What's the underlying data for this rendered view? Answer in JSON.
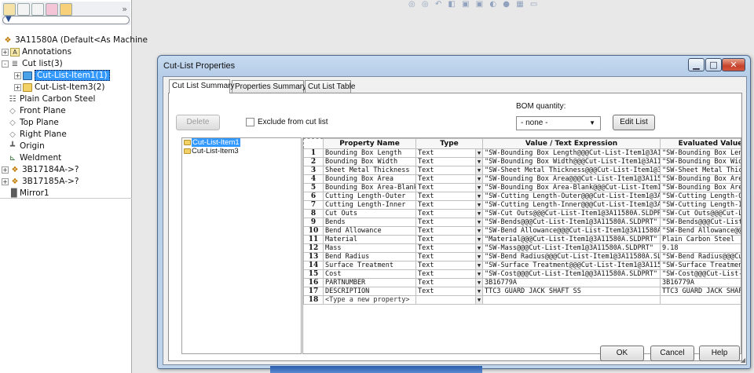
{
  "feature_manager": {
    "root_label": "3A11580A  (Default<As Machine",
    "items": [
      {
        "label": "Annotations",
        "icon": "annotation-icon",
        "expand": "+"
      },
      {
        "label": "Cut list(3)",
        "icon": "cut-list-icon",
        "expand": "-"
      },
      {
        "label": "Cut-List-Item1(1)",
        "icon": "folder-icon",
        "expand": "+",
        "selected": true
      },
      {
        "label": "Cut-List-Item3(2)",
        "icon": "folder-icon",
        "expand": "+"
      },
      {
        "label": "Plain Carbon Steel",
        "icon": "material-icon"
      },
      {
        "label": "Front Plane",
        "icon": "plane-icon"
      },
      {
        "label": "Top Plane",
        "icon": "plane-icon"
      },
      {
        "label": "Right Plane",
        "icon": "plane-icon"
      },
      {
        "label": "Origin",
        "icon": "origin-icon"
      },
      {
        "label": "Weldment",
        "icon": "weldment-icon"
      },
      {
        "label": "3B17184A->?",
        "icon": "part-icon",
        "expand": "+"
      },
      {
        "label": "3B17185A->?",
        "icon": "part-icon",
        "expand": "+"
      },
      {
        "label": "Mirror1",
        "icon": "mirror-icon"
      }
    ],
    "collapse_glyph": "»"
  },
  "dialog": {
    "title": "Cut-List Properties",
    "tabs": [
      "Cut List Summary",
      "Properties Summary",
      "Cut List Table"
    ],
    "delete_label": "Delete",
    "exclude_label": "Exclude from cut list",
    "bom_quantity_label": "BOM quantity:",
    "bom_quantity_value": "- none -",
    "edit_list_label": "Edit List",
    "cut_list_items": [
      "Cut-List-Item1",
      "Cut-List-Item3"
    ],
    "columns": [
      "Property Name",
      "Type",
      "Value / Text Expression",
      "Evaluated Value"
    ],
    "rows": [
      {
        "num": "1",
        "name": "Bounding Box Length",
        "type": "Text",
        "value": "\"SW-Bounding Box Length@@@Cut-List-Item1@3A115",
        "evaluated": "\"SW-Bounding Box Length@"
      },
      {
        "num": "2",
        "name": "Bounding Box Width",
        "type": "Text",
        "value": "\"SW-Bounding Box Width@@@Cut-List-Item1@3A1158",
        "evaluated": "\"SW-Bounding Box Width@"
      },
      {
        "num": "3",
        "name": "Sheet Metal Thickness",
        "type": "Text",
        "value": "\"SW-Sheet Metal Thickness@@@Cut-List-Item1@3A1",
        "evaluated": "\"SW-Sheet Metal Thickness"
      },
      {
        "num": "4",
        "name": "Bounding Box Area",
        "type": "Text",
        "value": "\"SW-Bounding Box Area@@@Cut-List-Item1@3A1158",
        "evaluated": "\"SW-Bounding Box Area@@"
      },
      {
        "num": "5",
        "name": "Bounding Box Area-Blank",
        "type": "Text",
        "value": "\"SW-Bounding Box Area-Blank@@@Cut-List-Item1@3",
        "evaluated": "\"SW-Bounding Box Area-Bla"
      },
      {
        "num": "6",
        "name": "Cutting Length-Outer",
        "type": "Text",
        "value": "\"SW-Cutting Length-Outer@@@Cut-List-Item1@3A115",
        "evaluated": "\"SW-Cutting Length-Outer@"
      },
      {
        "num": "7",
        "name": "Cutting Length-Inner",
        "type": "Text",
        "value": "\"SW-Cutting Length-Inner@@@Cut-List-Item1@3A115",
        "evaluated": "\"SW-Cutting Length-Inner@"
      },
      {
        "num": "8",
        "name": "Cut Outs",
        "type": "Text",
        "value": "\"SW-Cut Outs@@@Cut-List-Item1@3A11580A.SLDPRT",
        "evaluated": "\"SW-Cut Outs@@@Cut-List"
      },
      {
        "num": "9",
        "name": "Bends",
        "type": "Text",
        "value": "\"SW-Bends@@@Cut-List-Item1@3A11580A.SLDPRT\"",
        "evaluated": "\"SW-Bends@@@Cut-List-It"
      },
      {
        "num": "10",
        "name": "Bend Allowance",
        "type": "Text",
        "value": "\"SW-Bend Allowance@@@Cut-List-Item1@3A11580A.",
        "evaluated": "\"SW-Bend Allowance@@@"
      },
      {
        "num": "11",
        "name": "Material",
        "type": "Text",
        "value": "\"Material@@@Cut-List-Item1@3A11580A.SLDPRT\"",
        "evaluated": "Plain Carbon Steel"
      },
      {
        "num": "12",
        "name": "Mass",
        "type": "Text",
        "value": "\"SW-Mass@@@Cut-List-Item1@3A11580A.SLDPRT\"",
        "evaluated": "9.18"
      },
      {
        "num": "13",
        "name": "Bend Radius",
        "type": "Text",
        "value": "\"SW-Bend Radius@@@Cut-List-Item1@3A11580A.SLD",
        "evaluated": "\"SW-Bend Radius@@@Cut-"
      },
      {
        "num": "14",
        "name": "Surface Treatment",
        "type": "Text",
        "value": "\"SW-Surface Treatment@@@Cut-List-Item1@3A1158",
        "evaluated": "\"SW-Surface Treatment@@"
      },
      {
        "num": "15",
        "name": "Cost",
        "type": "Text",
        "value": "\"SW-Cost@@@Cut-List-Item1@@3A11580A.SLDPRT\"",
        "evaluated": "\"SW-Cost@@@Cut-List-Ite"
      },
      {
        "num": "16",
        "name": "PARTNUMBER",
        "type": "Text",
        "value": "3B16779A",
        "evaluated": "3B16779A"
      },
      {
        "num": "17",
        "name": "DESCRIPTION",
        "type": "Text",
        "value": "TTC3 GUARD JACK SHAFT SS",
        "evaluated": "TTC3 GUARD JACK SHAFT S"
      },
      {
        "num": "18",
        "name": "<Type a new property>",
        "type": "",
        "value": "",
        "evaluated": ""
      }
    ],
    "ok_label": "OK",
    "cancel_label": "Cancel",
    "help_label": "Help"
  }
}
